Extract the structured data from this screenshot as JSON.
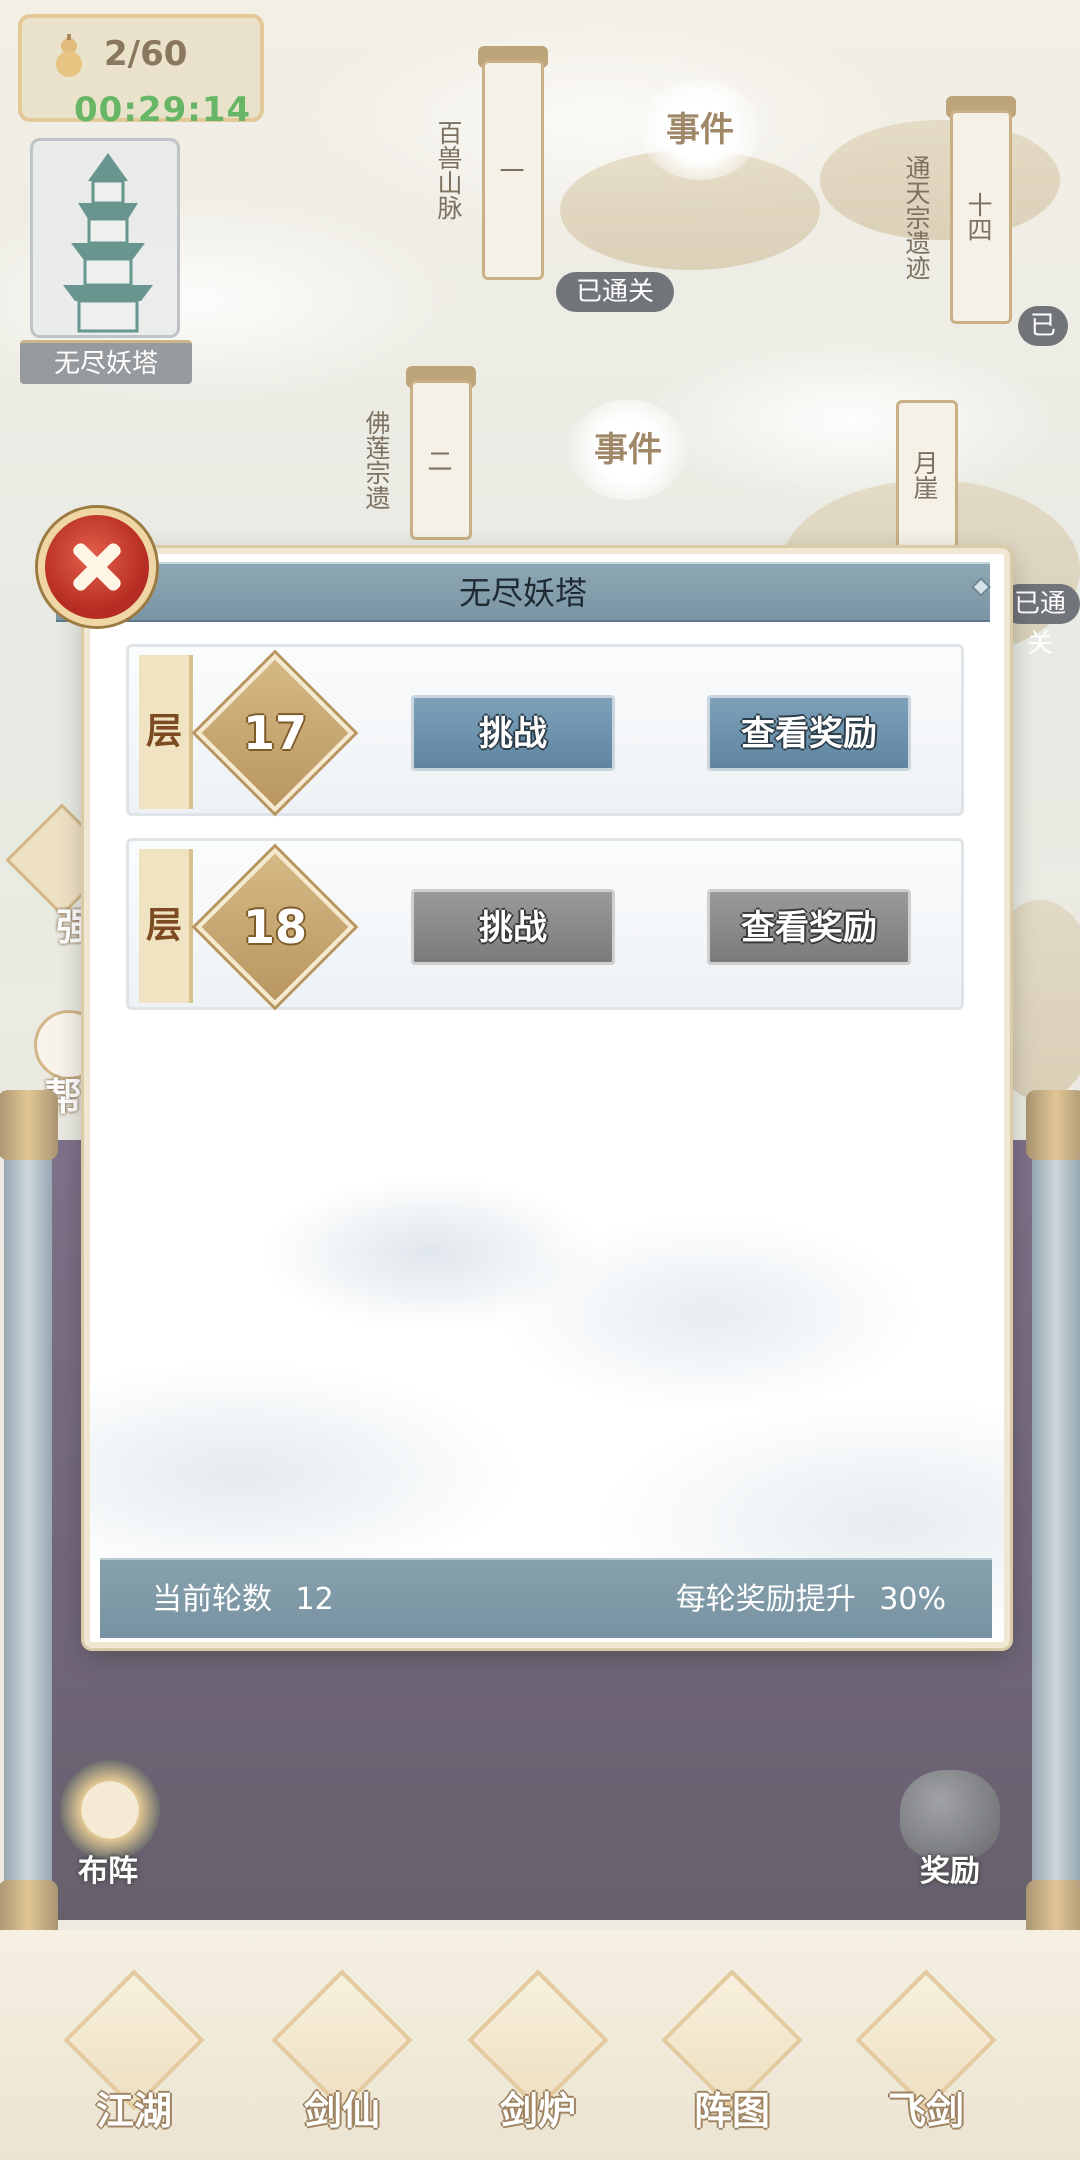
{
  "hud": {
    "stamina": "2/60",
    "timer": "00:29:14"
  },
  "map": {
    "tower_label": "无尽妖塔",
    "stages": [
      {
        "number": "一",
        "name": "百兽山脉"
      },
      {
        "number": "二",
        "name": "佛莲宗遗"
      },
      {
        "number": "十四",
        "name": "通天宗遗迹"
      },
      {
        "number": "",
        "name": "月崖"
      }
    ],
    "event_label": "事件",
    "passed_label": "已通关",
    "edge_labels": [
      "已",
      "已通关"
    ],
    "left_partial_labels": [
      "强",
      "帮"
    ]
  },
  "dialog": {
    "title": "无尽妖塔",
    "floor_label": "层",
    "floors": [
      {
        "floor": "17",
        "challenge": "挑战",
        "reward": "查看奖励",
        "state": "active"
      },
      {
        "floor": "18",
        "challenge": "挑战",
        "reward": "查看奖励",
        "state": "locked"
      }
    ],
    "footer": {
      "round_label": "当前轮数",
      "round_value": "12",
      "boost_label": "每轮奖励提升",
      "boost_value": "30%"
    }
  },
  "panel": {
    "formation_label": "布阵",
    "reward_label": "奖励"
  },
  "bottom_nav": [
    {
      "label": "江湖"
    },
    {
      "label": "剑仙"
    },
    {
      "label": "剑炉"
    },
    {
      "label": "阵图"
    },
    {
      "label": "飞剑"
    }
  ],
  "colors": {
    "active_button": "#6a8fab",
    "locked_button": "#8a8a8a",
    "title_bar": "#849eac",
    "timer_green": "#2c9a2c"
  }
}
